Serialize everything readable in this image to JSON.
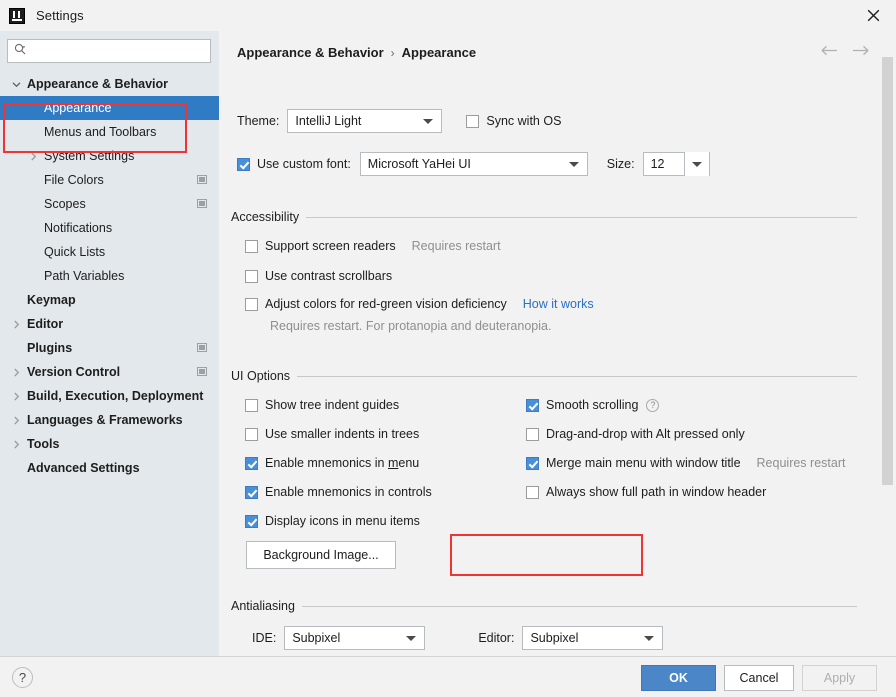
{
  "window": {
    "title": "Settings",
    "app_icon": "intellij-idea-icon",
    "close_icon": "close-icon"
  },
  "sidebar": {
    "search": {
      "placeholder": "",
      "value": "",
      "icon": "search-icon"
    },
    "items": [
      {
        "label": "Appearance & Behavior",
        "indent": 1,
        "twisty": "expanded",
        "bold": true,
        "selected": false,
        "badge": false
      },
      {
        "label": "Appearance",
        "indent": 2,
        "twisty": "none",
        "bold": false,
        "selected": true,
        "badge": false
      },
      {
        "label": "Menus and Toolbars",
        "indent": 2,
        "twisty": "none",
        "bold": false,
        "selected": false,
        "badge": false
      },
      {
        "label": "System Settings",
        "indent": 2,
        "twisty": "collapsed",
        "bold": false,
        "selected": false,
        "badge": false
      },
      {
        "label": "File Colors",
        "indent": 2,
        "twisty": "none",
        "bold": false,
        "selected": false,
        "badge": true
      },
      {
        "label": "Scopes",
        "indent": 2,
        "twisty": "none",
        "bold": false,
        "selected": false,
        "badge": true
      },
      {
        "label": "Notifications",
        "indent": 2,
        "twisty": "none",
        "bold": false,
        "selected": false,
        "badge": false
      },
      {
        "label": "Quick Lists",
        "indent": 2,
        "twisty": "none",
        "bold": false,
        "selected": false,
        "badge": false
      },
      {
        "label": "Path Variables",
        "indent": 2,
        "twisty": "none",
        "bold": false,
        "selected": false,
        "badge": false
      },
      {
        "label": "Keymap",
        "indent": 1,
        "twisty": "none",
        "bold": true,
        "selected": false,
        "badge": false
      },
      {
        "label": "Editor",
        "indent": 1,
        "twisty": "collapsed",
        "bold": true,
        "selected": false,
        "badge": false
      },
      {
        "label": "Plugins",
        "indent": 1,
        "twisty": "none",
        "bold": true,
        "selected": false,
        "badge": true
      },
      {
        "label": "Version Control",
        "indent": 1,
        "twisty": "collapsed",
        "bold": true,
        "selected": false,
        "badge": true
      },
      {
        "label": "Build, Execution, Deployment",
        "indent": 1,
        "twisty": "collapsed",
        "bold": true,
        "selected": false,
        "badge": false
      },
      {
        "label": "Languages & Frameworks",
        "indent": 1,
        "twisty": "collapsed",
        "bold": true,
        "selected": false,
        "badge": false
      },
      {
        "label": "Tools",
        "indent": 1,
        "twisty": "collapsed",
        "bold": true,
        "selected": false,
        "badge": false
      },
      {
        "label": "Advanced Settings",
        "indent": 1,
        "twisty": "none",
        "bold": true,
        "selected": false,
        "badge": false
      }
    ]
  },
  "content": {
    "breadcrumb": {
      "parent": "Appearance & Behavior",
      "separator": "›",
      "current": "Appearance"
    },
    "nav": {
      "back_icon": "arrow-left-icon",
      "forward_icon": "arrow-right-icon"
    },
    "theme": {
      "label": "Theme:",
      "value": "IntelliJ Light",
      "sync_label": "Sync with OS",
      "sync_checked": false
    },
    "font": {
      "use_custom_label": "Use custom font:",
      "use_custom_checked": true,
      "value": "Microsoft YaHei UI",
      "size_label": "Size:",
      "size_value": "12"
    },
    "accessibility": {
      "title": "Accessibility",
      "items": [
        {
          "label": "Support screen readers",
          "checked": false,
          "note": "Requires restart"
        },
        {
          "label": "Use contrast scrollbars",
          "checked": false,
          "note": ""
        },
        {
          "label": "Adjust colors for red-green vision deficiency",
          "checked": false,
          "link": "How it works"
        }
      ],
      "hint": "Requires restart. For protanopia and deuteranopia."
    },
    "ui_options": {
      "title": "UI Options",
      "left": [
        {
          "label": "Show tree indent guides",
          "checked": false
        },
        {
          "label": "Use smaller indents in trees",
          "checked": false
        },
        {
          "label": "Enable mnemonics in menu",
          "checked": true,
          "mnemonic": "m"
        },
        {
          "label": "Enable mnemonics in controls",
          "checked": true
        },
        {
          "label": "Display icons in menu items",
          "checked": true
        }
      ],
      "right": [
        {
          "label": "Smooth scrolling",
          "checked": true,
          "help": "?"
        },
        {
          "label": "Drag-and-drop with Alt pressed only",
          "checked": false
        },
        {
          "label": "Merge main menu with window title",
          "checked": true,
          "note": "Requires restart"
        },
        {
          "label": "Always show full path in window header",
          "checked": false
        }
      ],
      "background_image_button": "Background Image..."
    },
    "antialiasing": {
      "title": "Antialiasing",
      "ide_label": "IDE:",
      "ide_value": "Subpixel",
      "editor_label": "Editor:",
      "editor_value": "Subpixel"
    }
  },
  "footer": {
    "help_label": "?",
    "ok": "OK",
    "cancel": "Cancel",
    "apply": "Apply"
  },
  "colors": {
    "accent": "#4a86c8",
    "selection": "#2f7cc5",
    "sidebar_bg": "#e3e8ec",
    "content_bg": "#f2f2f2",
    "checkbox_checked": "#4a90d9",
    "link": "#2a6fc9",
    "annotation": "#f03434"
  }
}
